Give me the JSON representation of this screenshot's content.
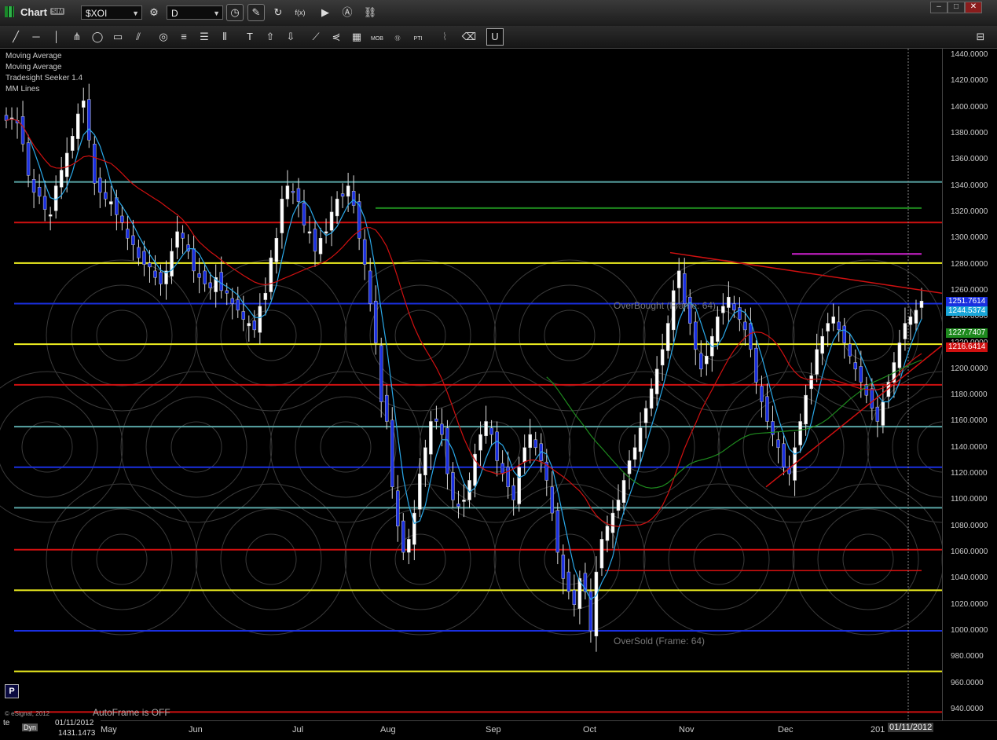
{
  "window": {
    "title": "Chart",
    "badge": "SIM"
  },
  "symbol_field": {
    "value": "$XOI"
  },
  "interval_field": {
    "value": "D"
  },
  "studies": [
    "Moving Average",
    "Moving Average",
    "Tradesight Seeker 1.4",
    "MM Lines"
  ],
  "annotations": {
    "overbought": "OverBought (Frame: 64)",
    "oversold": "OverSold (Frame: 64)",
    "autoframe": "AutoFrame is OFF",
    "copyright": "© eSignal, 2012"
  },
  "cursor_readout": {
    "date": "01/11/2012",
    "value": "1431.1473",
    "prefix": "te",
    "dyn": "Dyn"
  },
  "price_axis": {
    "ticks": [
      "1440.0000",
      "1420.0000",
      "1400.0000",
      "1380.0000",
      "1360.0000",
      "1340.0000",
      "1320.0000",
      "1300.0000",
      "1280.0000",
      "1260.0000",
      "1240.0000",
      "1220.0000",
      "1200.0000",
      "1180.0000",
      "1160.0000",
      "1140.0000",
      "1120.0000",
      "1100.0000",
      "1080.0000",
      "1060.0000",
      "1040.0000",
      "1020.0000",
      "1000.0000",
      "980.0000",
      "960.0000",
      "940.0000"
    ],
    "flags": [
      {
        "value": "1251.7614",
        "color": "#1a2fe0"
      },
      {
        "value": "1244.5374",
        "color": "#19a6d8"
      },
      {
        "value": "1227.7407",
        "color": "#1e8a1e"
      },
      {
        "value": "1216.6414",
        "color": "#d01010"
      }
    ]
  },
  "date_axis": {
    "labels": [
      "May",
      "Jun",
      "Jul",
      "Aug",
      "Sep",
      "Oct",
      "Nov",
      "Dec",
      "201"
    ],
    "cursor_label": "01/11/2012"
  },
  "chart_data": {
    "type": "candlestick",
    "symbol": "$XOI",
    "interval": "D",
    "y_range": [
      940,
      1445
    ],
    "mm_lines": [
      {
        "value": 1343,
        "color": "#5aa6a6"
      },
      {
        "value": 1312,
        "color": "#d01010"
      },
      {
        "value": 1281,
        "color": "#f0f020"
      },
      {
        "value": 1250,
        "color": "#1a2fe0"
      },
      {
        "value": 1219,
        "color": "#f0f020"
      },
      {
        "value": 1188,
        "color": "#d01010"
      },
      {
        "value": 1156,
        "color": "#5aa6a6"
      },
      {
        "value": 1125,
        "color": "#1a2fe0"
      },
      {
        "value": 1094,
        "color": "#5aa6a6"
      },
      {
        "value": 1062,
        "color": "#d01010"
      },
      {
        "value": 1031,
        "color": "#f0f020"
      },
      {
        "value": 1000,
        "color": "#1a2fe0"
      },
      {
        "value": 969,
        "color": "#f0f020"
      },
      {
        "value": 938,
        "color": "#d01010"
      }
    ],
    "levels": [
      {
        "value": 1323,
        "color": "#1e8a1e"
      },
      {
        "value": 1288,
        "color": "#d020d0"
      },
      {
        "value": 1046,
        "color": "#d01010"
      }
    ],
    "last_values": {
      "ma_blue": 1251.7614,
      "ma_cyan": 1244.5374,
      "ma_green": 1227.7407,
      "ma_red": 1216.6414
    },
    "closes": [
      1390,
      1392,
      1388,
      1372,
      1348,
      1335,
      1332,
      1322,
      1318,
      1340,
      1352,
      1365,
      1378,
      1395,
      1405,
      1375,
      1342,
      1335,
      1330,
      1328,
      1318,
      1312,
      1300,
      1295,
      1285,
      1280,
      1278,
      1270,
      1265,
      1275,
      1290,
      1305,
      1300,
      1290,
      1275,
      1270,
      1265,
      1262,
      1270,
      1260,
      1258,
      1250,
      1245,
      1238,
      1235,
      1230,
      1248,
      1258,
      1285,
      1300,
      1330,
      1340,
      1335,
      1328,
      1310,
      1305,
      1290,
      1300,
      1305,
      1320,
      1330,
      1332,
      1340,
      1325,
      1300,
      1280,
      1250,
      1220,
      1175,
      1160,
      1110,
      1080,
      1060,
      1070,
      1090,
      1120,
      1140,
      1160,
      1160,
      1150,
      1120,
      1100,
      1095,
      1100,
      1115,
      1135,
      1150,
      1160,
      1150,
      1130,
      1120,
      1110,
      1100,
      1125,
      1140,
      1150,
      1140,
      1130,
      1115,
      1090,
      1060,
      1040,
      1030,
      1020,
      1040,
      1030,
      1000,
      1045,
      1070,
      1080,
      1090,
      1100,
      1115,
      1130,
      1140,
      1155,
      1170,
      1185,
      1200,
      1215,
      1235,
      1260,
      1275,
      1250,
      1235,
      1215,
      1200,
      1210,
      1225,
      1240,
      1248,
      1255,
      1245,
      1238,
      1230,
      1215,
      1190,
      1175,
      1160,
      1150,
      1140,
      1125,
      1120,
      1140,
      1160,
      1180,
      1195,
      1215,
      1225,
      1235,
      1240,
      1230,
      1220,
      1210,
      1200,
      1190,
      1180,
      1170,
      1160,
      1175,
      1190,
      1205,
      1220,
      1235,
      1240,
      1245,
      1252
    ]
  }
}
